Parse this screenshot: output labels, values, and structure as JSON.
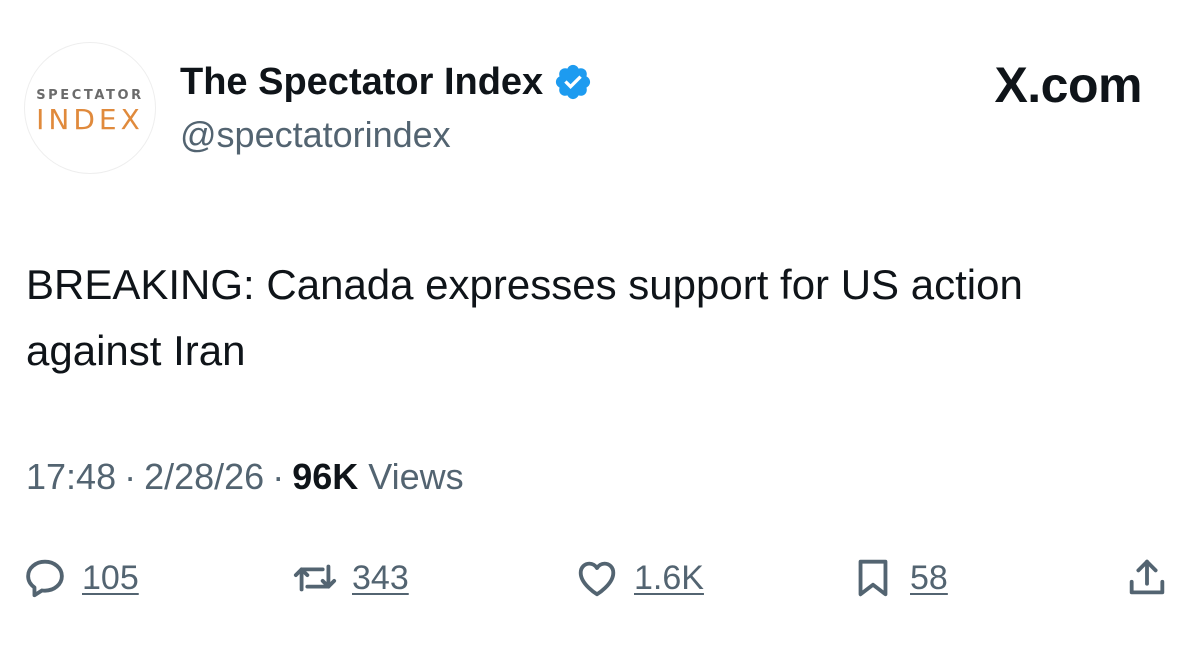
{
  "author": {
    "avatar_line1": "SPECTATOR",
    "avatar_line2": "INDEX",
    "display_name": "The Spectator Index",
    "handle": "@spectatorindex",
    "verified": true
  },
  "brand": "X.com",
  "tweet": {
    "text": "BREAKING: Canada expresses support for US action against Iran",
    "time": "17:48",
    "date": "2/28/26",
    "separator": "·",
    "views_count": "96K",
    "views_label": "Views"
  },
  "actions": {
    "replies": "105",
    "retweets": "343",
    "likes": "1.6K",
    "bookmarks": "58"
  },
  "colors": {
    "text_primary": "#0f1419",
    "text_secondary": "#536471",
    "verified_blue": "#1d9bf0",
    "avatar_orange": "#e08a3c"
  }
}
